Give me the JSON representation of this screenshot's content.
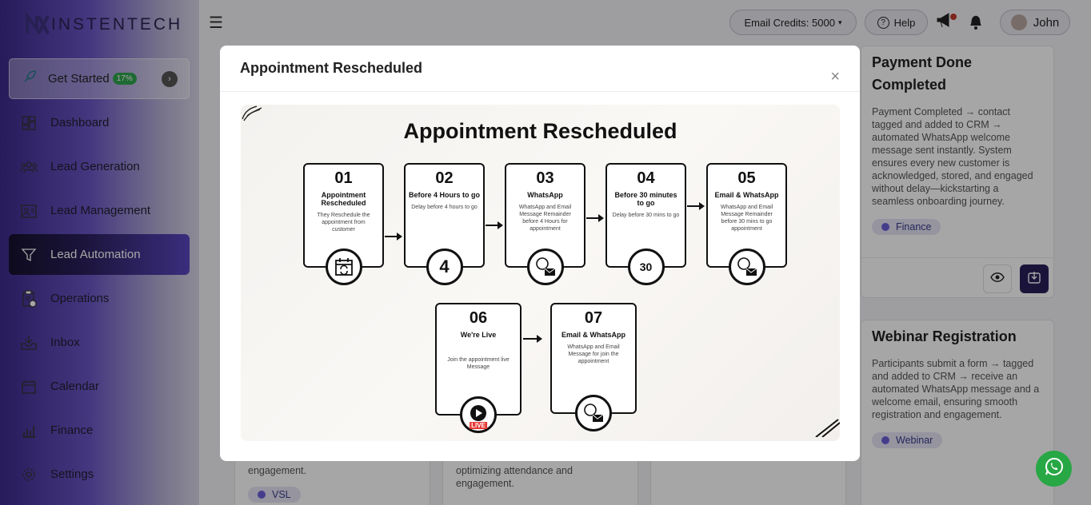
{
  "brand": {
    "name": "INSTENTECH"
  },
  "sidebar": {
    "get_started": {
      "label": "Get Started",
      "progress": "17%"
    },
    "items": [
      {
        "label": "Dashboard",
        "icon": "dashboard-icon"
      },
      {
        "label": "Lead Generation",
        "icon": "users-icon"
      },
      {
        "label": "Lead Management",
        "icon": "id-card-icon"
      },
      {
        "label": "Lead Automation",
        "icon": "funnel-icon",
        "active": true
      },
      {
        "label": "Operations",
        "icon": "clipboard-icon"
      },
      {
        "label": "Inbox",
        "icon": "inbox-icon"
      },
      {
        "label": "Calendar",
        "icon": "calendar-icon"
      },
      {
        "label": "Finance",
        "icon": "chart-icon"
      },
      {
        "label": "Settings",
        "icon": "gear-icon"
      }
    ]
  },
  "topbar": {
    "credits": "Email Credits: 5000",
    "help": "Help",
    "user": "John"
  },
  "cards": {
    "payment": {
      "title": "Payment Done Completed",
      "desc": "Payment Completed → contact tagged and added to CRM → automated WhatsApp welcome message sent instantly. System ensures every new customer is acknowledged, stored, and engaged without delay—kickstarting a seamless onboarding journey.",
      "tag": "Finance"
    },
    "webinar": {
      "title": "Webinar Registration",
      "desc": "Participants submit a form → tagged and added to CRM → receive an automated WhatsApp message and a welcome email, ensuring smooth registration and engagement.",
      "tag": "Webinar"
    },
    "bottom_left": {
      "desc": "engagement.",
      "tag": "VSL"
    },
    "bottom_mid": {
      "desc": "optimizing attendance and engagement."
    }
  },
  "modal": {
    "title": "Appointment Rescheduled",
    "close": "×",
    "flow_title": "Appointment Rescheduled",
    "steps": [
      {
        "num": "01",
        "name": "Appointment Rescheduled",
        "desc": "They Reschedule the appointment from customer"
      },
      {
        "num": "02",
        "name": "Before 4 Hours to go",
        "desc": "Delay before 4 hours to go"
      },
      {
        "num": "03",
        "name": "WhatsApp",
        "desc": "WhatsApp and Email Message Remainder before 4 Hours for appointment"
      },
      {
        "num": "04",
        "name": "Before 30 minutes to go",
        "desc": "Delay before 30 mins to go"
      },
      {
        "num": "05",
        "name": "Email & WhatsApp",
        "desc": "WhatsApp and Email Message Remainder before 30 mins to go appointment"
      },
      {
        "num": "06",
        "name": "We're Live",
        "desc": "Join the appointment live Message"
      },
      {
        "num": "07",
        "name": "Email & WhatsApp",
        "desc": "WhatsApp and Email Message for join the appointment"
      }
    ],
    "icon_text": {
      "four": "4",
      "thirty": "30",
      "live": "LIVE"
    }
  },
  "colors": {
    "accent": "#5a46c0",
    "whatsapp": "#28a745",
    "tag_dot": "#6a5ed8"
  }
}
